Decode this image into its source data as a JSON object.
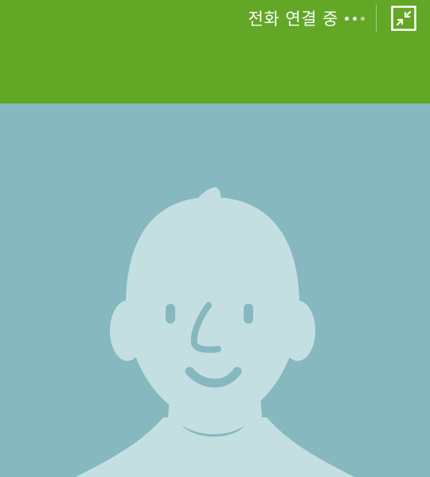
{
  "call": {
    "status_text": "전화 연결 중"
  },
  "icons": {
    "minimize": "minimize-icon",
    "avatar": "default-person-avatar"
  },
  "colors": {
    "topbar": "#62a726",
    "background": "#85b8bf",
    "avatar_fill": "#c4dfe2",
    "avatar_features": "#85b8bf"
  }
}
